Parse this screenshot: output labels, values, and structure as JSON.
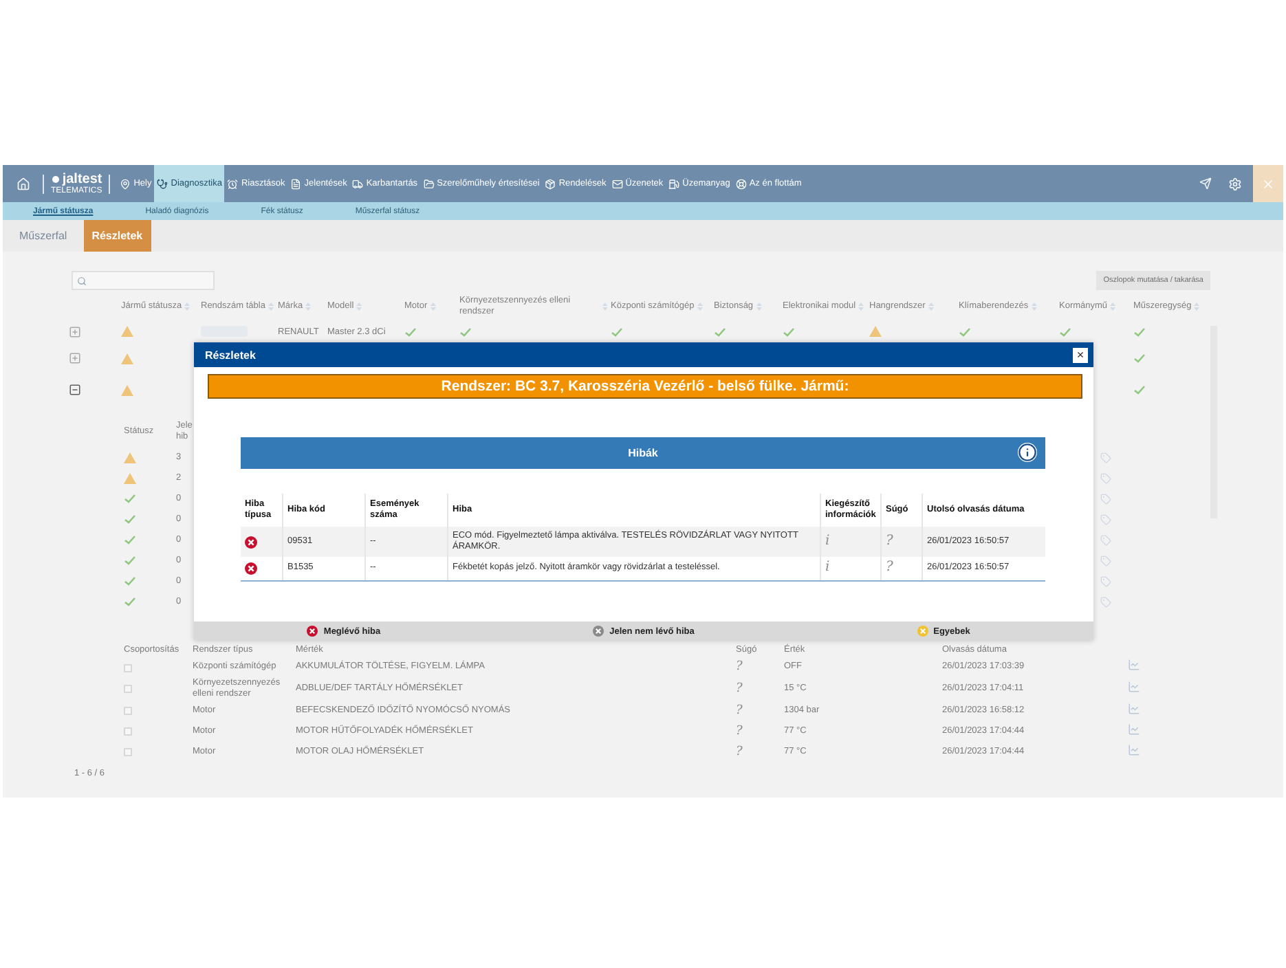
{
  "nav": {
    "brand": "jaltest",
    "tagline": "TELEMATICS",
    "items": [
      {
        "label": "Hely",
        "selected": false
      },
      {
        "label": "Diagnosztika",
        "selected": true
      },
      {
        "label": "Riasztások",
        "selected": false
      },
      {
        "label": "Jelentések",
        "selected": false
      },
      {
        "label": "Karbantartás",
        "selected": false
      },
      {
        "label": "Szerelőműhely értesítései",
        "selected": false
      },
      {
        "label": "Rendelések",
        "selected": false
      },
      {
        "label": "Üzenetek",
        "selected": false
      },
      {
        "label": "Üzemanyag",
        "selected": false
      },
      {
        "label": "Az én flottám",
        "selected": false
      }
    ]
  },
  "subnav": [
    {
      "label": "Jármű státusza",
      "selected": true
    },
    {
      "label": "Haladó diagnózis",
      "selected": false
    },
    {
      "label": "Fék státusz",
      "selected": false
    },
    {
      "label": "Műszerfal státusz",
      "selected": false
    }
  ],
  "tabs": [
    {
      "label": "Műszerfal",
      "selected": false
    },
    {
      "label": "Részletek",
      "selected": true
    }
  ],
  "vehicles": {
    "columns_button": "Oszlopok mutatása / takarása",
    "columns": [
      "Jármű státusza",
      "Rendszám tábla",
      "Márka",
      "Modell",
      "Motor",
      "Környezetszennyezés elleni rendszer",
      "Központi számítógép",
      "Biztonság",
      "Elektronikai modul",
      "Hangrendszer",
      "Klímaberendezés",
      "Kormánymű",
      "Műszeregység"
    ],
    "rows": [
      {
        "expanded": false,
        "warning": true,
        "brand": "RENAULT",
        "model": "Master 2.3 dCi",
        "systems": [
          {
            "warning": false
          },
          {
            "warning": false
          },
          {
            "warning": false
          },
          {
            "warning": false
          },
          {
            "warning": false
          },
          {
            "warning": true
          },
          {
            "warning": false
          },
          {
            "warning": false
          },
          {
            "warning": false
          }
        ]
      },
      {
        "expanded": false,
        "warning": true,
        "instrument_unit": {
          "warning": false
        }
      },
      {
        "expanded": true,
        "warning": true,
        "instrument_unit": {
          "warning": false
        }
      }
    ]
  },
  "status_table": {
    "columns": [
      "Státusz",
      "Jele hib"
    ],
    "rows": [
      {
        "warning": true,
        "count": "3"
      },
      {
        "warning": true,
        "count": "2"
      },
      {
        "warning": false,
        "count": "0"
      },
      {
        "warning": false,
        "count": "0"
      },
      {
        "warning": false,
        "count": "0"
      },
      {
        "warning": false,
        "count": "0"
      },
      {
        "warning": false,
        "count": "0"
      },
      {
        "warning": false,
        "count": "0"
      }
    ]
  },
  "measures": {
    "columns": [
      "Csoportosítás",
      "Rendszer típus",
      "Mérték",
      "Súgó",
      "Érték",
      "Olvasás dátuma"
    ],
    "rows": [
      {
        "checked": false,
        "system": "Központi számítógép",
        "measure": "AKKUMULÁTOR TÖLTÉSE, FIGYELM. LÁMPA",
        "help": "?",
        "value": "OFF",
        "date": "26/01/2023 17:03:39"
      },
      {
        "checked": false,
        "system": "Környezetszennyezés elleni rendszer",
        "measure": "ADBLUE/DEF TARTÁLY HŐMÉRSÉKLET",
        "help": "?",
        "value": "15 °C",
        "date": "26/01/2023 17:04:11"
      },
      {
        "checked": false,
        "system": "Motor",
        "measure": "BEFECSKENDEZŐ IDŐZÍTŐ NYOMÓCSŐ NYOMÁS",
        "help": "?",
        "value": "1304 bar",
        "date": "26/01/2023 16:58:12"
      },
      {
        "checked": false,
        "system": "Motor",
        "measure": "MOTOR HŰTŐFOLYADÉK HŐMÉRSÉKLET",
        "help": "?",
        "value": "77 °C",
        "date": "26/01/2023 17:04:44"
      },
      {
        "checked": false,
        "system": "Motor",
        "measure": "MOTOR OLAJ HŐMÉRSÉKLET",
        "help": "?",
        "value": "77 °C",
        "date": "26/01/2023 17:04:44"
      }
    ],
    "pagination": "1 - 6 / 6"
  },
  "modal": {
    "title": "Részletek",
    "close": "×",
    "banner": "Rendszer: BC 3.7, Karosszéria Vezérlő - belső fülke. Jármű:",
    "section": "Hibák",
    "columns": [
      "Hiba típusa",
      "Hiba kód",
      "Események száma",
      "Hiba",
      "Kiegészítő információk",
      "Súgó",
      "Utolsó olvasás dátuma"
    ],
    "rows": [
      {
        "kind": "present",
        "code": "09531",
        "events": "--",
        "description": "ECO mód. Figyelmeztető lámpa aktiválva. TESTELÉS RÖVIDZÁRLAT VAGY NYITOTT ÁRAMKÖR.",
        "info": "i",
        "help": "?",
        "date": "26/01/2023 16:50:57"
      },
      {
        "kind": "present",
        "code": "B1535",
        "events": "--",
        "description": "Fékbetét kopás jelző. Nyitott áramkör vagy rövidzárlat a testeléssel.",
        "info": "i",
        "help": "?",
        "date": "26/01/2023 16:50:57"
      }
    ],
    "legend": [
      {
        "kind": "present",
        "label": "Meglévő hiba"
      },
      {
        "kind": "absent",
        "label": "Jelen nem lévő hiba"
      },
      {
        "kind": "other",
        "label": "Egyebek"
      }
    ]
  }
}
